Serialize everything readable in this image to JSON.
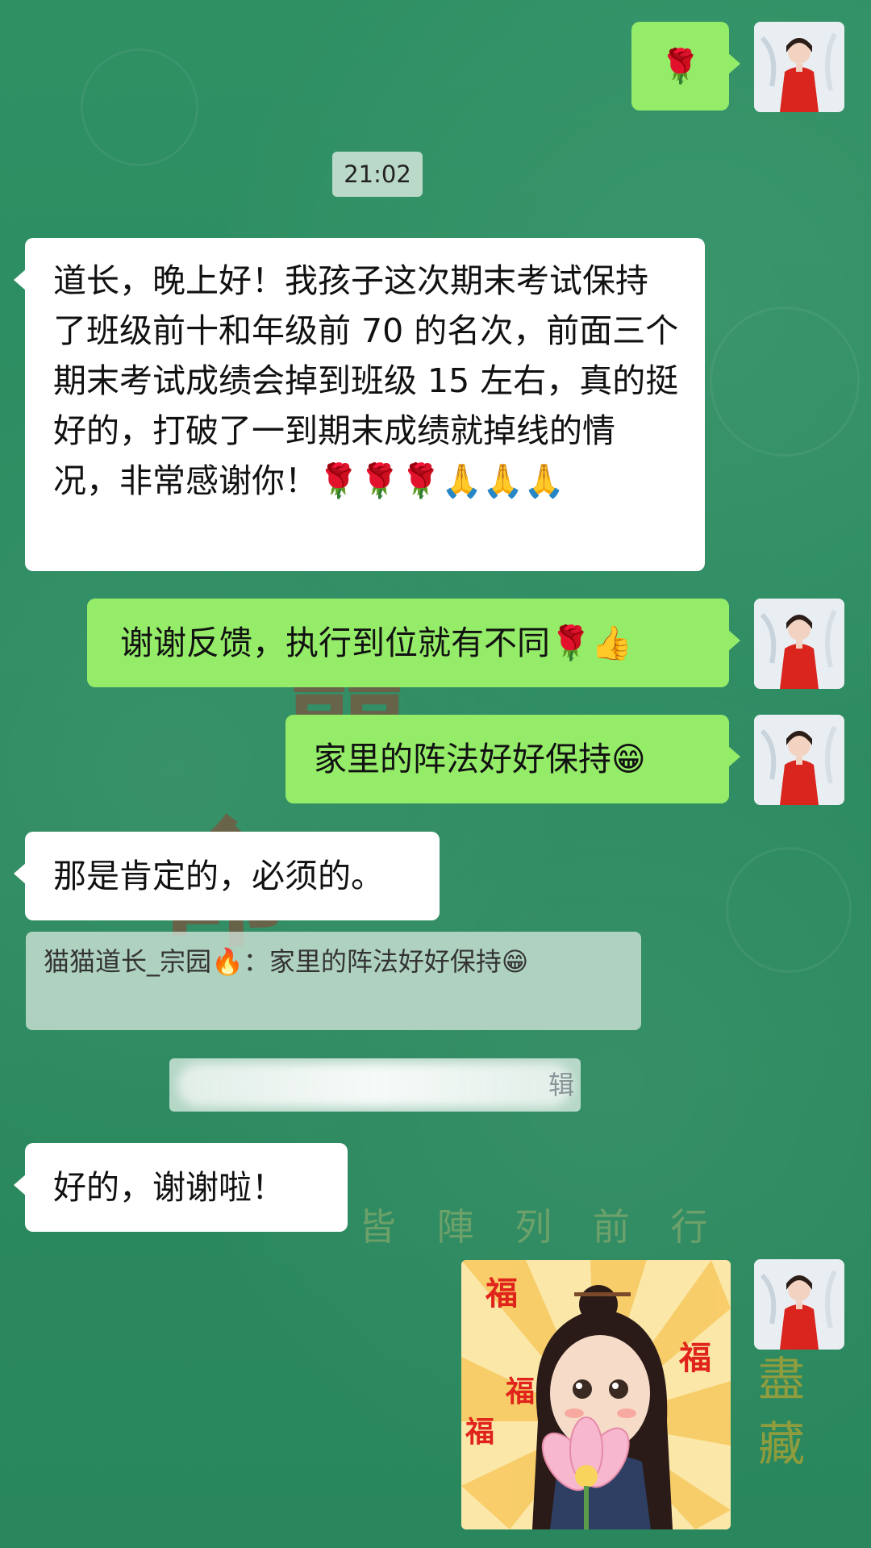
{
  "chat": {
    "timestamp": "21:02",
    "messages": [
      {
        "side": "right",
        "text": "🌹"
      },
      {
        "side": "left",
        "text": "道长，晚上好！我孩子这次期末考试保持了班级前十和年级前 70 的名次，前面三个期末考试成绩会掉到班级 15 左右，真的挺好的，打破了一到期末成绩就掉线的情况，非常感谢你！🌹🌹🌹🙏🙏🙏"
      },
      {
        "side": "right",
        "text": "谢谢反馈，执行到位就有不同🌹👍"
      },
      {
        "side": "right",
        "text": "家里的阵法好好保持😁"
      },
      {
        "side": "left",
        "text": "那是肯定的，必须的。"
      },
      {
        "side": "left",
        "text": "好的，谢谢啦！"
      }
    ],
    "quote": {
      "author": "猫猫道长_宗园🔥",
      "separator": "：",
      "text": "家里的阵法好好保持😁"
    },
    "blurred_tail": "辑",
    "sticker_chars": [
      "福",
      "福",
      "福",
      "福"
    ]
  },
  "background": {
    "slogan": "皆 陣 列 前 行",
    "side_text": "盡藏"
  }
}
